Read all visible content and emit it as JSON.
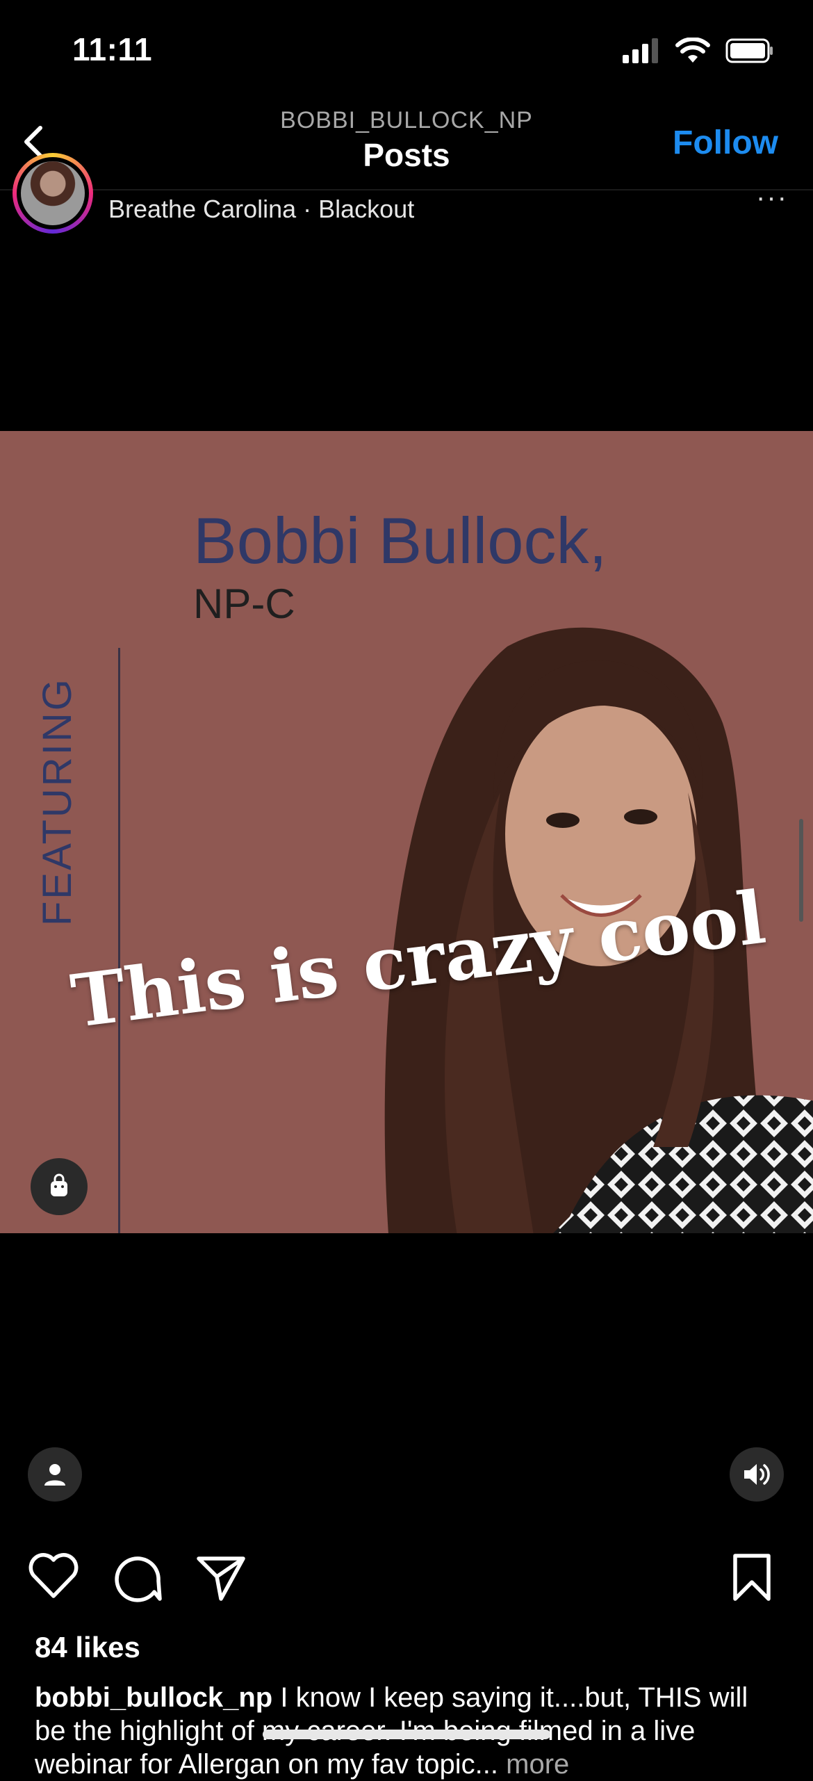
{
  "status_bar": {
    "time": "11:11"
  },
  "header": {
    "username": "BOBBI_BULLOCK_NP",
    "title": "Posts",
    "follow_label": "Follow"
  },
  "post": {
    "music": "Breathe Carolina · Blackout",
    "more_icon": "ellipsis-icon",
    "media": {
      "name": "Bobbi Bullock,",
      "credentials": "NP-C",
      "featuring": "FEATURING",
      "overlay_text": "This is crazy cool"
    },
    "likes": "84 likes",
    "caption": {
      "username": "bobbi_bullock_np",
      "text": "I know I keep saying it....but, THIS will be the highlight of my career. I'm being filmed in a live webinar for Allergan on my fav topic...",
      "more_label": "more"
    }
  },
  "colors": {
    "background": "#000000",
    "accent": "#1d8cf0",
    "media_bg": "#8f5852",
    "name_color": "#2f3867"
  }
}
